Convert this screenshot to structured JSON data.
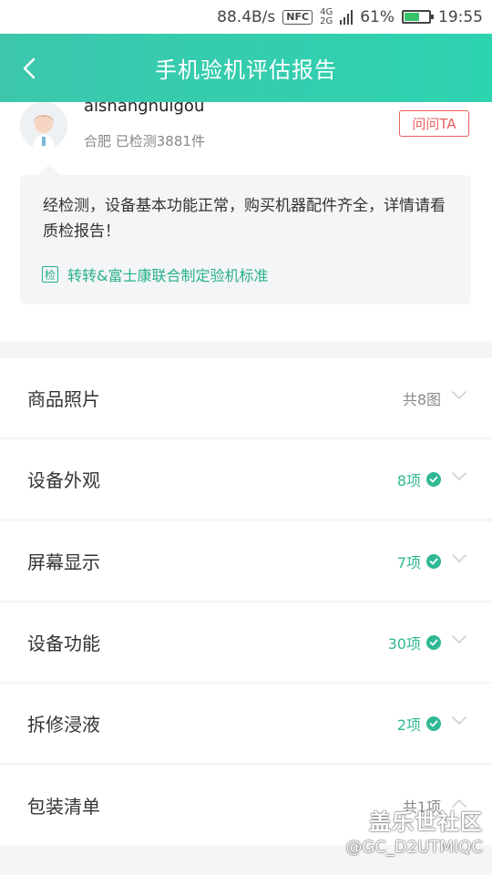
{
  "status_bar": {
    "speed": "88.4B/s",
    "nfc": "NFC",
    "network_top": "4G",
    "network_bottom": "2G",
    "battery_text": "61%",
    "battery_level": 0.61,
    "time": "19:55"
  },
  "header": {
    "title": "手机验机评估报告",
    "back_icon": "chevron-left-icon"
  },
  "inspector": {
    "username": "aishanghuigou",
    "meta": "合肥 已检测3881件",
    "ask_label": "问问TA"
  },
  "summary": {
    "message": "经检测，设备基本功能正常，购买机器配件齐全，详情请看质检报告！",
    "badge": "检",
    "standard_link": "转转&富士康联合制定验机标准"
  },
  "sections": [
    {
      "label": "商品照片",
      "value": "共8图",
      "status": "gray",
      "check": false,
      "chevron": "down"
    },
    {
      "label": "设备外观",
      "value": "8项",
      "status": "green",
      "check": true,
      "chevron": "down"
    },
    {
      "label": "屏幕显示",
      "value": "7项",
      "status": "green",
      "check": true,
      "chevron": "down"
    },
    {
      "label": "设备功能",
      "value": "30项",
      "status": "green",
      "check": true,
      "chevron": "down"
    },
    {
      "label": "拆修浸液",
      "value": "2项",
      "status": "green",
      "check": true,
      "chevron": "down"
    },
    {
      "label": "包装清单",
      "value": "共1项",
      "status": "gray",
      "check": false,
      "chevron": "up"
    }
  ],
  "watermark": {
    "line1": "盖乐世社区",
    "line2": "@GC_D2UTMIQC"
  },
  "colors": {
    "header_start": "#3cc7ad",
    "accent_green": "#2fb893",
    "ask_red": "#e8605c"
  }
}
